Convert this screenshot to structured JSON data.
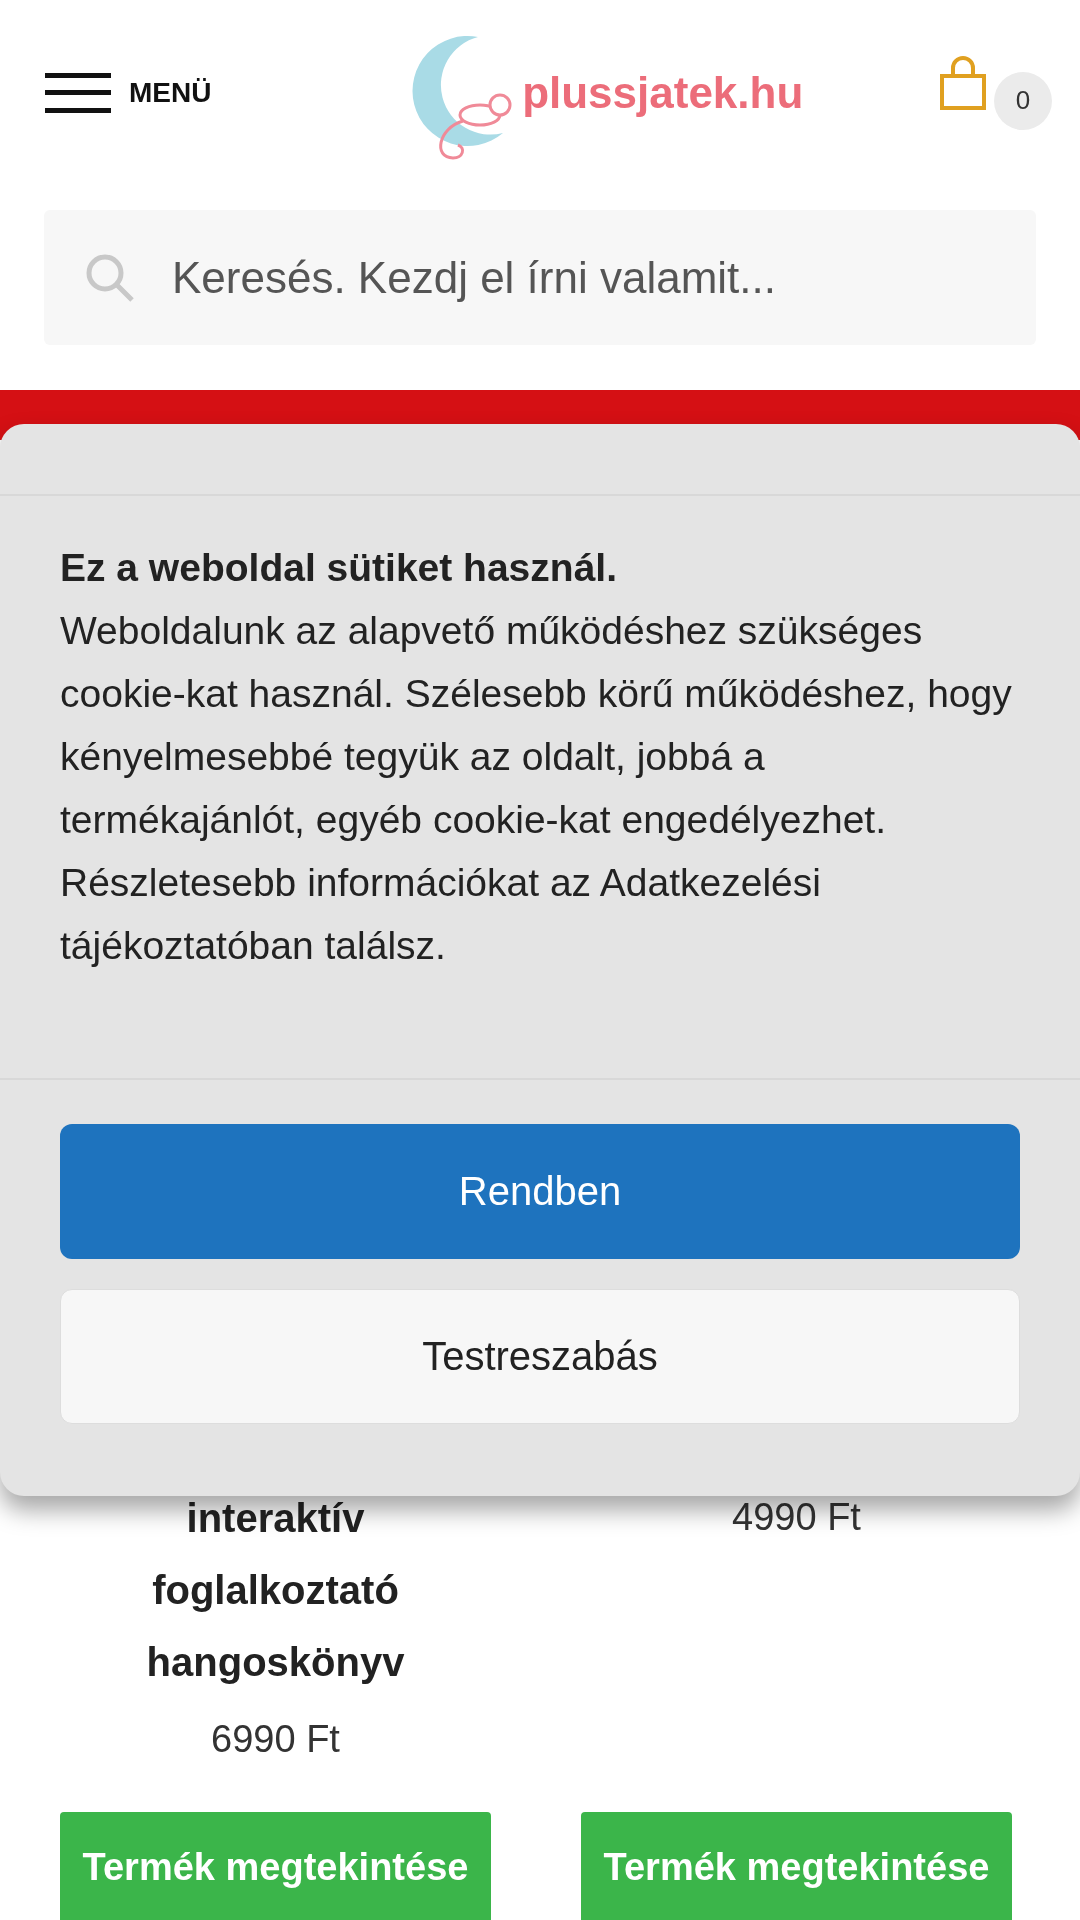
{
  "header": {
    "menu_label": "MENÜ",
    "logo_text": "plussjatek.hu",
    "cart_count": "0"
  },
  "search": {
    "placeholder": "Keresés. Kezdj el írni valamit..."
  },
  "cookie_dialog": {
    "title": "Ez a weboldal sütiket használ.",
    "body": "Weboldalunk az alapvető működéshez szükséges cookie-kat használ. Szélesebb körű működéshez, hogy kényelmesebbé tegyük az oldalt, jobbá a termékajánlót, egyéb cookie-kat engedélyezhet. Részletesebb információkat az Adatkezelési tájékoztatóban találsz.",
    "buttons": [
      {
        "label": "Rendben",
        "kind": "primary"
      },
      {
        "label": "Testreszabás",
        "kind": "secondary"
      }
    ]
  },
  "products": [
    {
      "title": "interaktív foglalkoztató hangoskönyv",
      "price": "6990 Ft",
      "button": "Termék megtekintése"
    },
    {
      "price": "4990 Ft",
      "button": "Termék megtekintése"
    }
  ]
}
